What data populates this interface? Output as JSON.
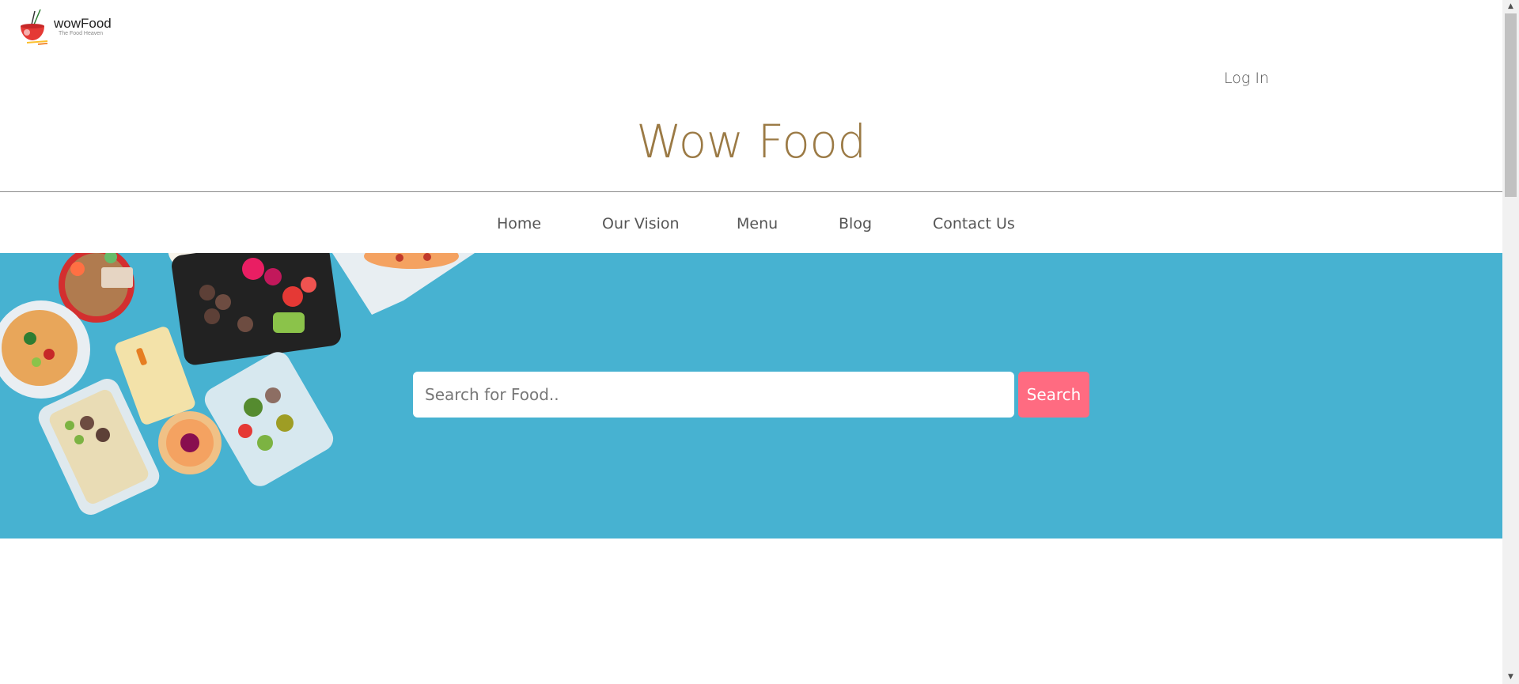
{
  "logo": {
    "name": "wowFood",
    "tagline": "The Food Heaven"
  },
  "header": {
    "login_label": "Log In",
    "title": "Wow Food"
  },
  "nav": {
    "items": [
      {
        "label": "Home"
      },
      {
        "label": "Our Vision"
      },
      {
        "label": "Menu"
      },
      {
        "label": "Blog"
      },
      {
        "label": "Contact Us"
      }
    ]
  },
  "search": {
    "placeholder": "Search for Food..",
    "value": "",
    "button_label": "Search"
  },
  "colors": {
    "hero_bg": "#47b2d1",
    "accent": "#ff6b81",
    "title": "#9b7a45"
  },
  "icons": [
    "food-bowl-logo-icon",
    "scroll-up-arrow-icon",
    "scroll-down-arrow-icon"
  ]
}
